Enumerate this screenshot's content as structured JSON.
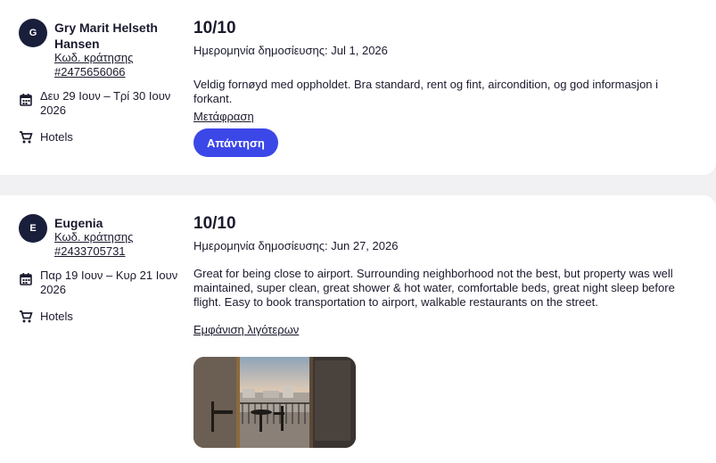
{
  "reviews": [
    {
      "avatar_letter": "G",
      "name": "Gry Marit Helseth Hansen",
      "booking_label": "Κωδ. κράτησης",
      "booking_id": "#2475656066",
      "stay_dates": "Δευ 29 Ιουν – Τρί 30 Ιουν 2026",
      "category": "Hotels",
      "score": "10/10",
      "published": "Ημερομηνία δημοσίευσης: Jul 1, 2026",
      "text": "Veldig fornøyd med oppholdet. Bra standard, rent og fint, aircondition, og god informasjon i forkant.",
      "translate_label": "Μετάφραση",
      "reply_label": "Απάντηση"
    },
    {
      "avatar_letter": "E",
      "name": "Eugenia",
      "booking_label": "Κωδ. κράτησης",
      "booking_id": "#2433705731",
      "stay_dates": "Παρ 19 Ιουν – Κυρ 21 Ιουν 2026",
      "category": "Hotels",
      "score": "10/10",
      "published": "Ημερομηνία δημοσίευσης: Jun 27, 2026",
      "text": "Great for being close to airport. Surrounding neighborhood not the best, but property was well maintained, super clean, great shower & hot water, comfortable beds, great night sleep before flight. Easy to book transportation to airport, walkable restaurants on the street.",
      "show_less_label": "Εμφάνιση λιγότερων"
    }
  ],
  "icons": {
    "dates": "calendar-icon",
    "category": "cart-icon"
  },
  "colors": {
    "accent": "#3c47e8",
    "avatar": "#191e3b",
    "background": "#f1f1f3"
  }
}
